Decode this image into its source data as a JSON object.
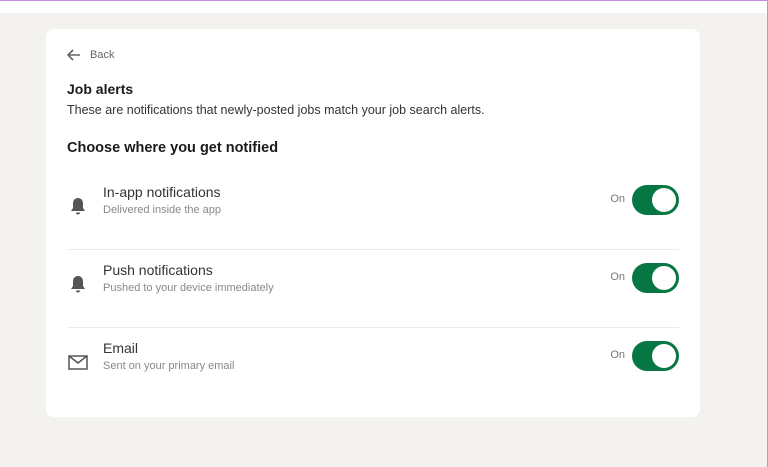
{
  "back_label": "Back",
  "title": "Job alerts",
  "description": "These are notifications that newly-posted jobs match your job search alerts.",
  "section_title": "Choose where you get notified",
  "options": [
    {
      "label": "In-app notifications",
      "sub": "Delivered inside the app",
      "state": "On",
      "icon": "bell-icon"
    },
    {
      "label": "Push notifications",
      "sub": "Pushed to your device immediately",
      "state": "On",
      "icon": "bell-icon"
    },
    {
      "label": "Email",
      "sub": "Sent on your primary email",
      "state": "On",
      "icon": "envelope-icon"
    }
  ],
  "colors": {
    "toggle_on": "#067642",
    "background": "#f3f2ef"
  }
}
